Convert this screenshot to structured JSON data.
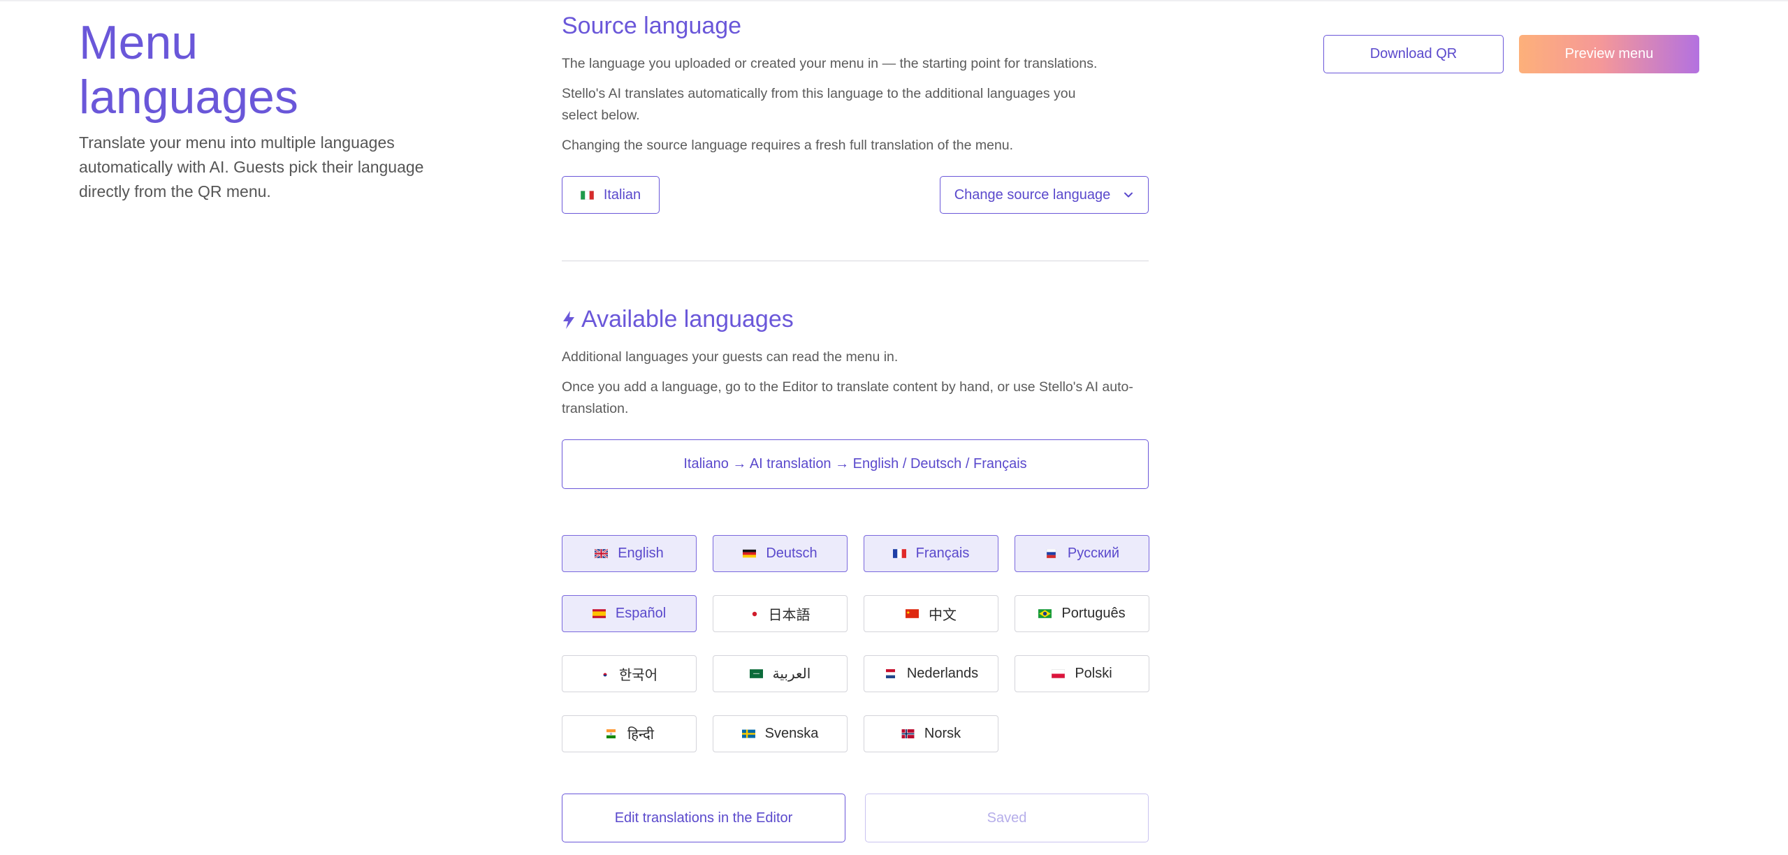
{
  "header": {
    "title": "Menu languages",
    "description": "Translate your menu into multiple languages automatically with AI. Guests pick their language directly from the QR menu.",
    "download_qr_label": "Download QR",
    "preview_menu_label": "Preview menu"
  },
  "source": {
    "title": "Source language",
    "p1": "The language you uploaded or created your menu in — the starting point for translations.",
    "p2": "Stello's AI translates automatically from this language to the additional languages you select below.",
    "p3": "Changing the source language requires a fresh full translation of the menu.",
    "current_language": "Italian",
    "change_label": "Change source language"
  },
  "available": {
    "title": "Available languages",
    "p1": "Additional languages your guests can read the menu in.",
    "p2": "Once you add a language, go to the Editor to translate content by hand, or use Stello's AI auto-translation.",
    "flow": "Italiano → AI translation → English / Deutsch / Français",
    "languages": [
      {
        "label": "English",
        "flag": "uk-flag",
        "selected": true
      },
      {
        "label": "Deutsch",
        "flag": "de-flag",
        "selected": true
      },
      {
        "label": "Français",
        "flag": "fr-flag",
        "selected": true
      },
      {
        "label": "Русский",
        "flag": "ru-flag",
        "selected": true
      },
      {
        "label": "Español",
        "flag": "es-flag",
        "selected": true
      },
      {
        "label": "日本語",
        "flag": "jp-flag",
        "selected": false
      },
      {
        "label": "中文",
        "flag": "cn-flag",
        "selected": false
      },
      {
        "label": "Português",
        "flag": "br-flag",
        "selected": false
      },
      {
        "label": "한국어",
        "flag": "kr-flag",
        "selected": false
      },
      {
        "label": "العربية",
        "flag": "sa-flag",
        "selected": false
      },
      {
        "label": "Nederlands",
        "flag": "nl-flag",
        "selected": false
      },
      {
        "label": "Polski",
        "flag": "pl-flag",
        "selected": false
      },
      {
        "label": "हिन्दी",
        "flag": "in-flag",
        "selected": false
      },
      {
        "label": "Svenska",
        "flag": "se-flag",
        "selected": false
      },
      {
        "label": "Norsk",
        "flag": "no-flag",
        "selected": false
      }
    ]
  },
  "footer": {
    "edit_label": "Edit translations in the Editor",
    "saved_label": "Saved"
  },
  "colors": {
    "accent": "#6a57d9",
    "selected_bg": "#ecebfb",
    "muted_text": "#5b5b5b"
  }
}
